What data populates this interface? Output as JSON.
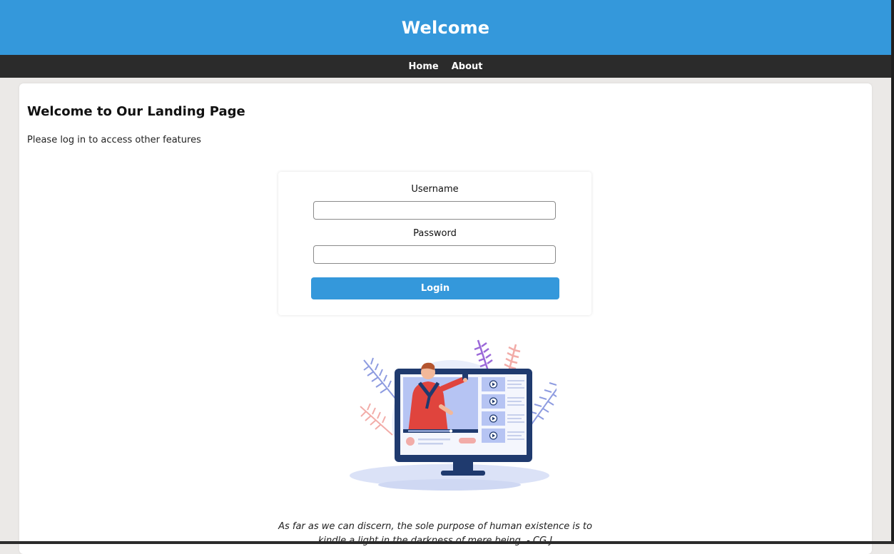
{
  "header": {
    "title": "Welcome"
  },
  "nav": {
    "home": "Home",
    "about": "About"
  },
  "main": {
    "heading": "Welcome to Our Landing Page",
    "lead": "Please log in to access other features"
  },
  "login": {
    "username_label": "Username",
    "username_value": "",
    "password_label": "Password",
    "password_value": "",
    "button_label": "Login"
  },
  "quote": "As far as we can discern, the sole purpose of human existence is to kindle a light in the darkness of mere being. - CG.J",
  "colors": {
    "accent": "#3498db",
    "nav_bg": "#2b2b2b",
    "page_bg": "#ebe9e7"
  },
  "illustration": {
    "icon": "video-player-illustration"
  }
}
